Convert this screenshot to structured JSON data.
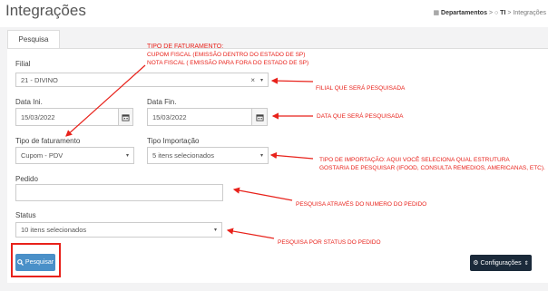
{
  "header": {
    "title": "Integrações",
    "breadcrumb": {
      "item1": "Departamentos",
      "sep": ">",
      "item2": "TI",
      "item3": "Integrações"
    }
  },
  "tabs": [
    {
      "label": "Pesquisa"
    }
  ],
  "form": {
    "filial": {
      "label": "Filial",
      "value": "21 - DIVINO",
      "clear": "×",
      "caret": "▾"
    },
    "data_ini": {
      "label": "Data Ini.",
      "value": "15/03/2022"
    },
    "data_fin": {
      "label": "Data Fin.",
      "value": "15/03/2022"
    },
    "tipo_faturamento": {
      "label": "Tipo de faturamento",
      "value": "Cupom - PDV"
    },
    "tipo_importacao": {
      "label": "Tipo Importação",
      "value": "5 itens selecionados"
    },
    "pedido": {
      "label": "Pedido",
      "value": ""
    },
    "status": {
      "label": "Status",
      "value": "10 itens selecionados"
    }
  },
  "buttons": {
    "pesquisar": "Pesquisar",
    "configuracoes": "Configurações"
  },
  "annotations": {
    "tipo_faturamento_title": "TIPO DE FATURAMENTO:",
    "tipo_faturamento_line1": "CUPOM FISCAL (EMISSÃO DENTRO DO ESTADO DE SP)",
    "tipo_faturamento_line2": "NOTA FISCAL ( EMISSÃO PARA FORA DO ESTADO DE SP)",
    "filial": "FILIAL QUE SERÁ PESQUISADA",
    "data": "DATA QUE SERÁ PESQUISADA",
    "importacao_line1": "TIPO DE IMPORTAÇÃO: AQUI VOCÊ SELECIONA QUAL ESTRUTURA",
    "importacao_line2": "GOSTARIA DE PESQUISAR (IFOOD, CONSULTA REMEDIOS, AMERICANAS, ETC).",
    "pedido": "PESQUISA ATRAVÉS DO NUMERO DO PEDIDO",
    "status": "PESQUISA POR STATUS DO PEDIDO"
  },
  "icons": {
    "calendar": "calendar-icon",
    "search": "search-icon",
    "gear": "gear-icon",
    "sitemap": "sitemap-icon",
    "home": "home-icon"
  },
  "colors": {
    "annotation_red": "#e8221b",
    "search_button": "#4a90c8",
    "config_button": "#1b2a3a"
  }
}
